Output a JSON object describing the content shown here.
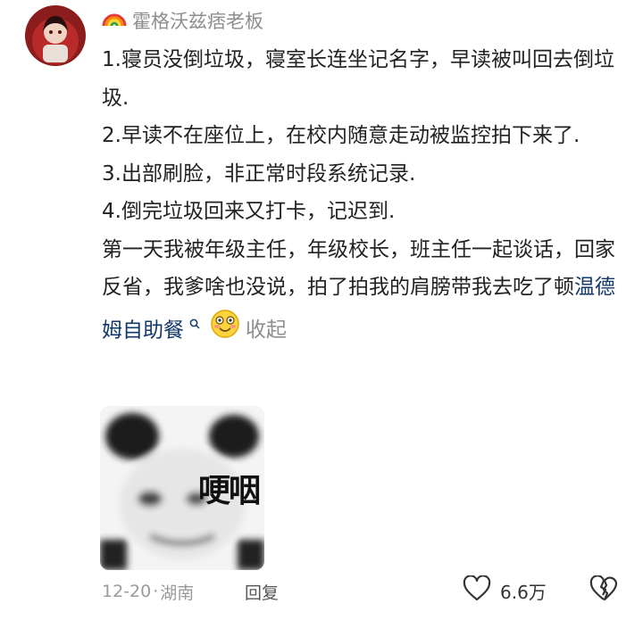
{
  "comment": {
    "username": "霍格沃兹痞老板",
    "username_icon": "rainbow-icon",
    "lines": [
      "1.寝员没倒垃圾，寝室长连坐记名字，早读被叫回去倒垃圾.",
      "2.早读不在座位上，在校内随意走动被监控拍下来了.",
      "3.出部刷脸，非正常时段系统记录.",
      "4.倒完垃圾回来又打卡，记迟到."
    ],
    "paragraph": "第一天我被年级主任，年级校长，班主任一起谈话，回家反省，我爹啥也没说，拍了拍我的肩膀带我去吃了顿",
    "link_text": "温德姆自助餐",
    "link_icon": "search-icon",
    "emoji": "grinning-emoji-icon",
    "collapse_label": "收起",
    "meme_text": "哽咽",
    "date": "12-20",
    "separator": "·",
    "location": "湖南",
    "reply_label": "回复",
    "like_count": "6.6万"
  },
  "colors": {
    "link": "#13386c",
    "muted": "#8e8e8e",
    "text": "#222222"
  }
}
